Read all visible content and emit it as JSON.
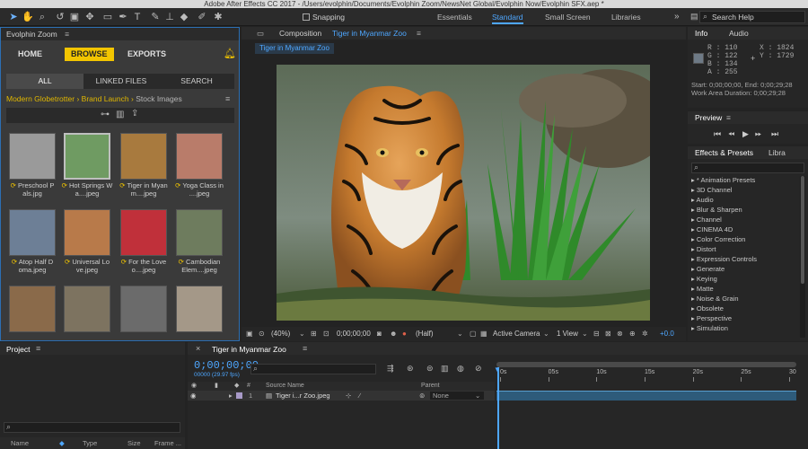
{
  "window": {
    "title": "Adobe After Effects CC 2017 - /Users/evolphin/Documents/Evolphin Zoom/NewsNet Global/Evolphin Now/Evolphin SFX.aep *"
  },
  "toolbar": {
    "snapping_label": "Snapping",
    "workspaces": [
      "Essentials",
      "Standard",
      "Small Screen",
      "Libraries"
    ],
    "active_workspace": "Standard",
    "search_placeholder": "Search Help"
  },
  "evolphin": {
    "panel_title": "Evolphin Zoom",
    "nav": {
      "home": "HOME",
      "browse": "BROWSE",
      "exports": "EXPORTS"
    },
    "subtabs": [
      "ALL",
      "LINKED FILES",
      "SEARCH"
    ],
    "breadcrumb": {
      "first": "Modern Globetrotter",
      "sep": "›",
      "second": "Brand Launch",
      "last": "Stock Images"
    },
    "thumbs": [
      {
        "line1": "Preschool P",
        "line2": "als.jpg",
        "color": "#9a9a9a"
      },
      {
        "line1": "Hot Springs W",
        "line2": "a....jpeg",
        "color": "#6f9b62"
      },
      {
        "line1": "Tiger in Myan",
        "line2": "m....jpeg",
        "color": "#a87a3e"
      },
      {
        "line1": "Yoga Class in",
        "line2": "....jpeg",
        "color": "#b97c6a"
      },
      {
        "line1": "Atop Half D",
        "line2": "oma.jpeg",
        "color": "#6d7f96"
      },
      {
        "line1": "Universal Lo",
        "line2": "ve.jpeg",
        "color": "#b87a4a"
      },
      {
        "line1": "For the Love",
        "line2": "o....jpeg",
        "color": "#c0303a"
      },
      {
        "line1": "Cambodian",
        "line2": "Elem....jpeg",
        "color": "#6e7c5e"
      },
      {
        "line1": "",
        "line2": "",
        "color": "#8a6a4a"
      },
      {
        "line1": "",
        "line2": "",
        "color": "#7d7360"
      },
      {
        "line1": "",
        "line2": "",
        "color": "#6b6b6b"
      },
      {
        "line1": "",
        "line2": "",
        "color": "#a49888"
      }
    ]
  },
  "composition": {
    "label": "Composition",
    "name": "Tiger in Myanmar Zoo",
    "subtab": "Tiger in Myanmar Zoo",
    "controls": {
      "zoom": "(40%)",
      "timecode": "0;00;00;00",
      "resolution": "(Half)",
      "camera": "Active Camera",
      "views": "1 View",
      "exposure": "+0.0"
    }
  },
  "info": {
    "tabs": [
      "Info",
      "Audio"
    ],
    "r": "R : 110",
    "g": "G : 122",
    "b": "B : 134",
    "a": "A : 255",
    "x": "X : 1824",
    "y": "Y : 1729",
    "start": "Start: 0;00;00;00, End: 0;00;29;28",
    "duration": "Work Area Duration: 0;00;29;28",
    "swatch": "#6e7a86"
  },
  "preview": {
    "title": "Preview"
  },
  "effects": {
    "tabs": [
      "Effects & Presets",
      "Libra"
    ],
    "search_placeholder": "",
    "items": [
      "* Animation Presets",
      "3D Channel",
      "Audio",
      "Blur & Sharpen",
      "Channel",
      "CINEMA 4D",
      "Color Correction",
      "Distort",
      "Expression Controls",
      "Generate",
      "Keying",
      "Matte",
      "Noise & Grain",
      "Obsolete",
      "Perspective",
      "Simulation"
    ]
  },
  "project": {
    "title": "Project",
    "columns": [
      "Name",
      "Type",
      "Size",
      "Frame ..."
    ]
  },
  "timeline": {
    "tab": "Tiger in Myanmar Zoo",
    "timecode": "0;00;00;00",
    "fps": "00000 (29.97 fps)",
    "columns": {
      "source": "Source Name",
      "parent": "Parent"
    },
    "layer": {
      "num": "1",
      "name": "Tiger i...r Zoo.jpeg",
      "parent": "None"
    },
    "ruler_ticks": [
      "0s",
      "05s",
      "10s",
      "15s",
      "20s",
      "25s",
      "30"
    ]
  }
}
